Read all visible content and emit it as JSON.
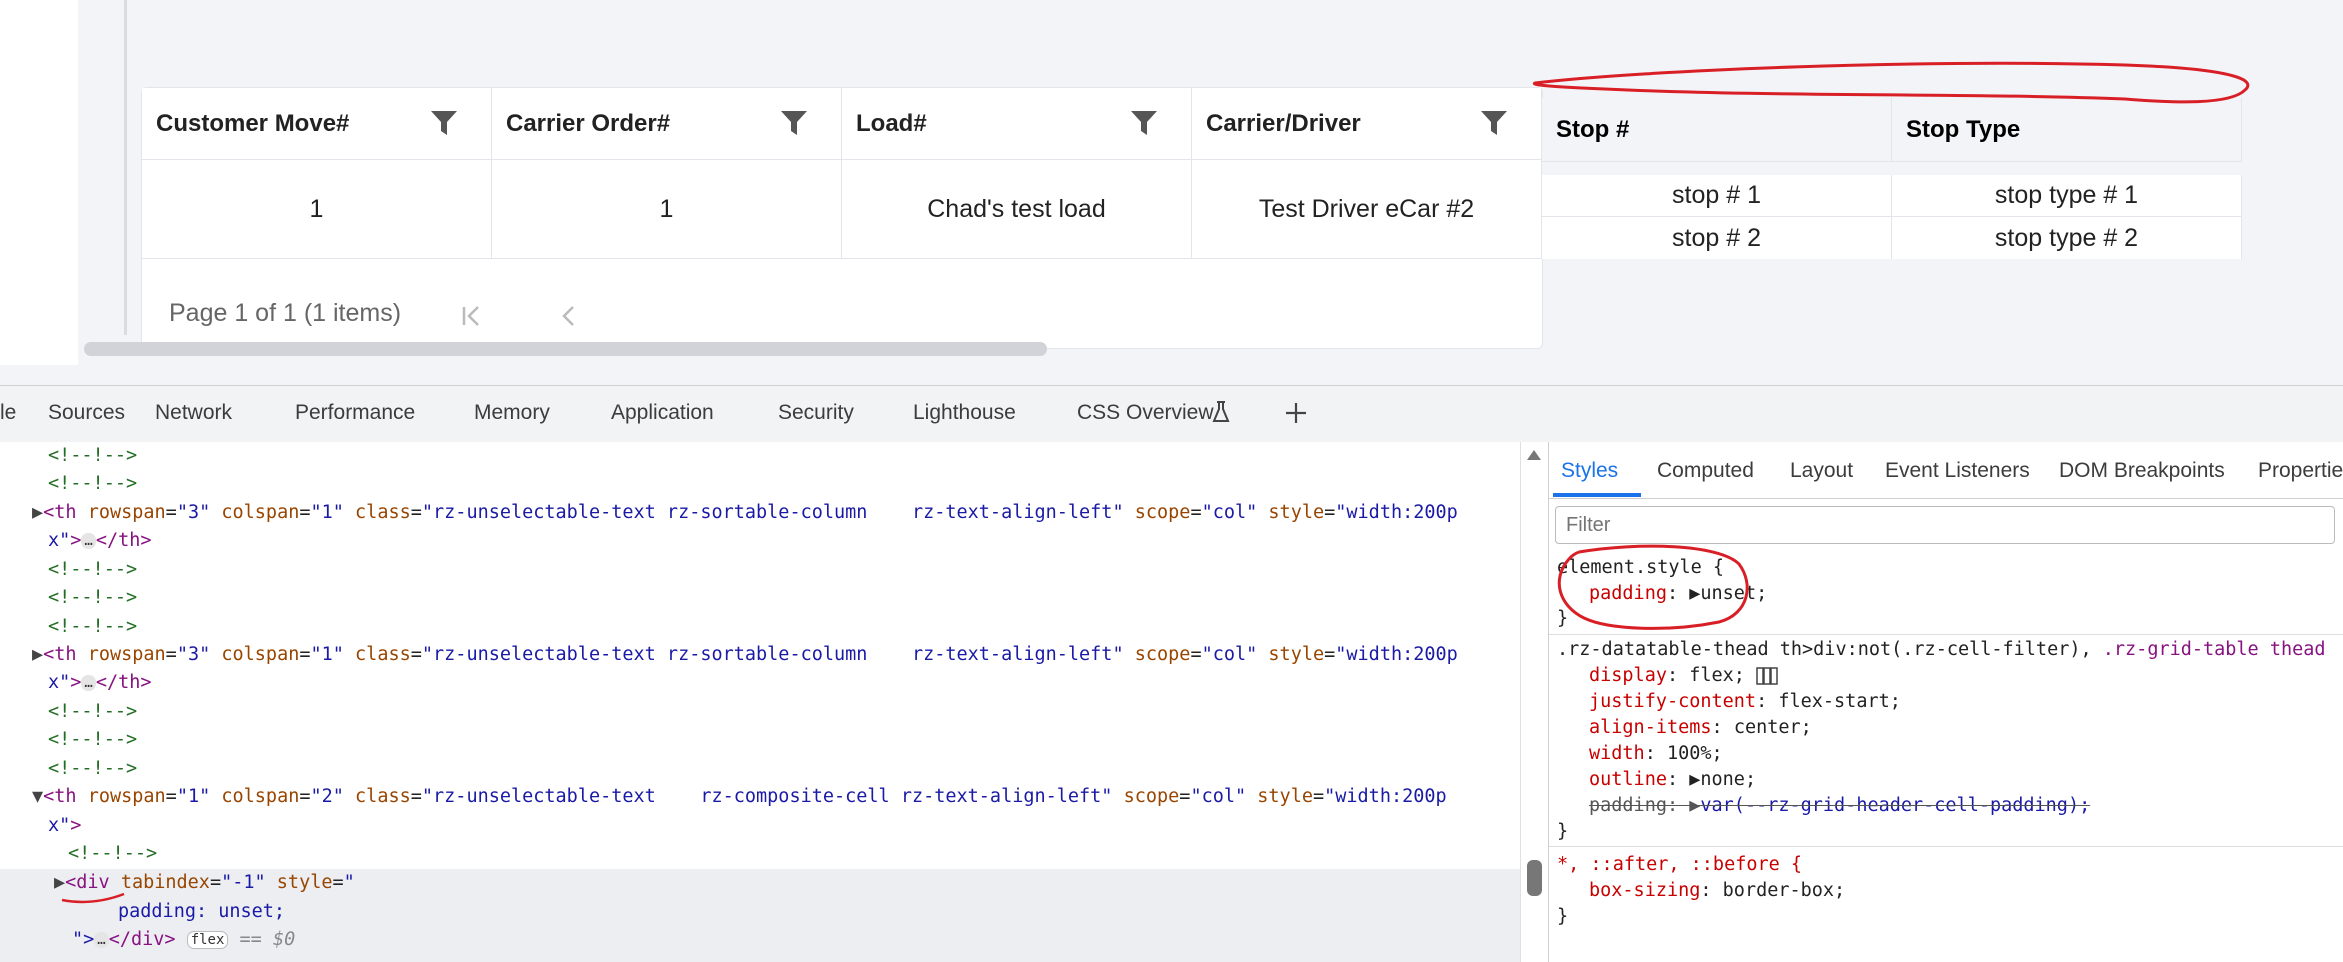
{
  "grid": {
    "headers": [
      "Customer Move#",
      "Carrier Order#",
      "Load#",
      "Carrier/Driver"
    ],
    "row": [
      "1",
      "1",
      "Chad's test load",
      "Test Driver eCar #2"
    ],
    "sub_headers": [
      "Stop #",
      "Stop Type"
    ],
    "sub_rows": [
      [
        "stop # 1",
        "stop type # 1"
      ],
      [
        "stop # 2",
        "stop type # 2"
      ]
    ],
    "pager_text": "Page 1 of 1 (1 items)",
    "first_page_icon": "first-page-icon",
    "prev_page_icon": "prev-page-icon",
    "filter_icon": "funnel-icon"
  },
  "devtools": {
    "tabs": [
      "le",
      "Sources",
      "Network",
      "Performance",
      "Memory",
      "Application",
      "Security",
      "Lighthouse",
      "CSS Overview"
    ],
    "add_tab_icon": "plus-icon",
    "beaker_icon": "beaker-icon",
    "elements": {
      "comment": "<!--!-->",
      "th_rowspan3": {
        "open": "<th",
        "rowspan_attr": "rowspan",
        "rowspan_val": "\"3\"",
        "colspan_attr": "colspan",
        "colspan_val": "\"1\"",
        "class_attr": "class",
        "class_val": "\"rz-unselectable-text rz-sortable-column    rz-text-align-left\"",
        "scope_attr": "scope",
        "scope_val": "\"col\"",
        "style_attr": "style",
        "style_val": "\"width:200p",
        "style_cont": "x\"",
        "close": "</th>"
      },
      "th_composite": {
        "rowspan_val": "\"1\"",
        "colspan_val": "\"2\"",
        "class_val": "\"rz-unselectable-text    rz-composite-cell rz-text-align-left\""
      },
      "div_open": "<div",
      "tabindex_attr": "tabindex",
      "tabindex_val": "\"-1\"",
      "style_attr": "style",
      "style_val_open": "\"",
      "padding_line": "padding: unset;",
      "div_close_quote": "\">",
      "div_close": "</div>",
      "flex_badge": "flex",
      "dollar": "== $0",
      "th_close_bracket": ">",
      "ellipsis": "…"
    },
    "styles_tabs": [
      "Styles",
      "Computed",
      "Layout",
      "Event Listeners",
      "DOM Breakpoints",
      "Properties"
    ],
    "filter_placeholder": "Filter",
    "rules": {
      "element_style": "element.style {",
      "padding_prop": "padding",
      "padding_val": "unset;",
      "close": "}",
      "rule2_selector_a": ".rz-datatable-thead th>div:not(.rz-cell-filter), ",
      "rule2_selector_b": ".rz-grid-table thead",
      "display": [
        "display",
        "flex;"
      ],
      "justify": [
        "justify-content",
        "flex-start;"
      ],
      "align": [
        "align-items",
        "center;"
      ],
      "width": [
        "width",
        "100%;"
      ],
      "outline": [
        "outline",
        "none;"
      ],
      "padding_struck": [
        "padding",
        "var(--rz-grid-header-cell-padding);"
      ],
      "rule3_selector": "*, ::after, ::before {",
      "box_sizing": [
        "box-sizing",
        "border-box;"
      ]
    }
  },
  "colors": {
    "annotation_red": "#d91f26",
    "annotation_blue": "#1e2a8a",
    "active_tab": "#1a73e8"
  }
}
